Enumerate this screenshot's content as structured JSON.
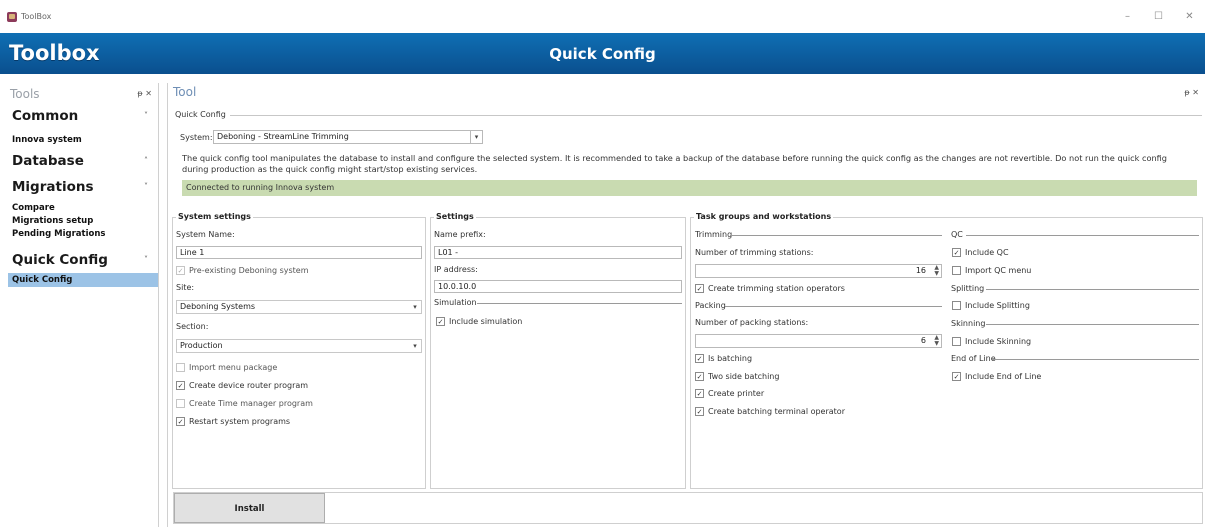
{
  "window": {
    "title": "ToolBox",
    "controls": {
      "minimize": "–",
      "maximize": "☐",
      "close": "✕"
    }
  },
  "banner": {
    "brand": "Toolbox",
    "title": "Quick Config"
  },
  "sidebar": {
    "title": "Tools",
    "pin": "ᵽ ✕",
    "groups": [
      {
        "label": "Common",
        "chevron": "˅",
        "items": [
          "Innova system"
        ]
      },
      {
        "label": "Database",
        "chevron": "˄",
        "items": []
      },
      {
        "label": "Migrations",
        "chevron": "˅",
        "items": [
          "Compare",
          "Migrations setup",
          "Pending Migrations"
        ]
      },
      {
        "label": "Quick Config",
        "chevron": "˅",
        "items": [
          "Quick Config"
        ]
      }
    ]
  },
  "tool": {
    "title": "Tool",
    "pin": "ᵽ ✕",
    "legend": "Quick Config",
    "system_label": "System:",
    "system_value": "Deboning - StreamLine Trimming",
    "description": "The quick config tool manipulates the database to install and configure the selected system. It is recommended to take a backup of the database before running the quick config as the changes are not revertible. Do not run the quick config during production as the quick config might start/stop existing services.",
    "status": "Connected to running Innova system"
  },
  "system_settings": {
    "title": "System settings",
    "system_name_label": "System Name:",
    "system_name_value": "Line 1",
    "preexisting": "Pre-existing Deboning system",
    "site_label": "Site:",
    "site_value": "Deboning Systems",
    "section_label": "Section:",
    "section_value": "Production",
    "import_menu": "Import menu package",
    "device_router": "Create device router program",
    "time_manager": "Create Time manager program",
    "restart": "Restart system programs"
  },
  "settings": {
    "title": "Settings",
    "name_prefix_label": "Name prefix:",
    "name_prefix_value": "L01 -",
    "ip_label": "IP address:",
    "ip_value": "10.0.10.0",
    "simulation_label": "Simulation",
    "include_simulation": "Include simulation"
  },
  "tasks": {
    "title": "Task groups and workstations",
    "trimming": "Trimming",
    "trimming_count_label": "Number of trimming stations:",
    "trimming_count": "16",
    "trimming_ops": "Create trimming station operators",
    "packing": "Packing",
    "packing_count_label": "Number of packing stations:",
    "packing_count": "6",
    "is_batching": "Is batching",
    "two_side": "Two side batching",
    "printer": "Create printer",
    "batching_op": "Create batching terminal operator",
    "qc": "QC",
    "include_qc": "Include QC",
    "import_qc": "Import QC menu",
    "splitting": "Splitting",
    "include_splitting": "Include Splitting",
    "skinning": "Skinning",
    "include_skinning": "Include Skinning",
    "eol": "End of Line",
    "include_eol": "Include End of Line"
  },
  "install_label": "Install",
  "check": "✓"
}
